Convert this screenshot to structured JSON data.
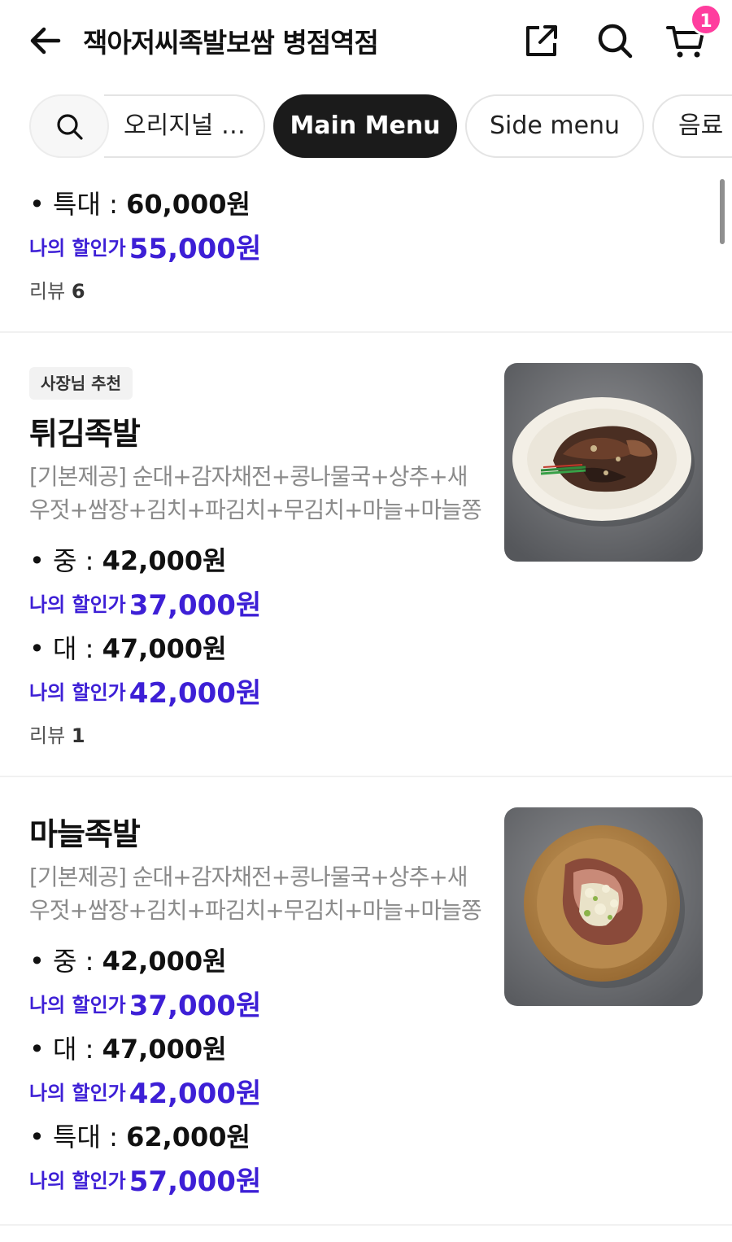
{
  "header": {
    "title": "잭아저씨족발보쌈 병점역점",
    "cart_count": "1"
  },
  "chips": {
    "original": "오리지널 …",
    "main": "Main Menu",
    "side": "Side menu",
    "drink": "음료"
  },
  "discount_label": "나의 할인가",
  "review_label": "리뷰",
  "item0": {
    "p1_label": "• 특대 : ",
    "p1_price": "60,000원",
    "p1_disc": "55,000원",
    "reviews": "6"
  },
  "item1": {
    "badge": "사장님 추천",
    "name": "튀김족발",
    "desc_line1": "[기본제공] 순대+감자채전+콩나물국+상추+새",
    "desc_line2": "우젓+쌈장+김치+파김치+무김치+마늘+마늘쫑",
    "p1_label": "• 중 : ",
    "p1_price": "42,000원",
    "p1_disc": "37,000원",
    "p2_label": "• 대 : ",
    "p2_price": "47,000원",
    "p2_disc": "42,000원",
    "reviews": "1"
  },
  "item2": {
    "name": "마늘족발",
    "desc_line1": "[기본제공] 순대+감자채전+콩나물국+상추+새",
    "desc_line2": "우젓+쌈장+김치+파김치+무김치+마늘+마늘쫑",
    "p1_label": "• 중 : ",
    "p1_price": "42,000원",
    "p1_disc": "37,000원",
    "p2_label": "• 대 : ",
    "p2_price": "47,000원",
    "p2_disc": "42,000원",
    "p3_label": "• 특대 : ",
    "p3_price": "62,000원",
    "p3_disc": "57,000원"
  },
  "icons": {
    "back": "arrow-left-icon",
    "share": "share-icon",
    "search": "search-icon",
    "cart": "cart-icon"
  },
  "colors": {
    "discount": "#3d1fd6",
    "badge": "#ff3d9e",
    "active_chip": "#1b1b1b"
  }
}
